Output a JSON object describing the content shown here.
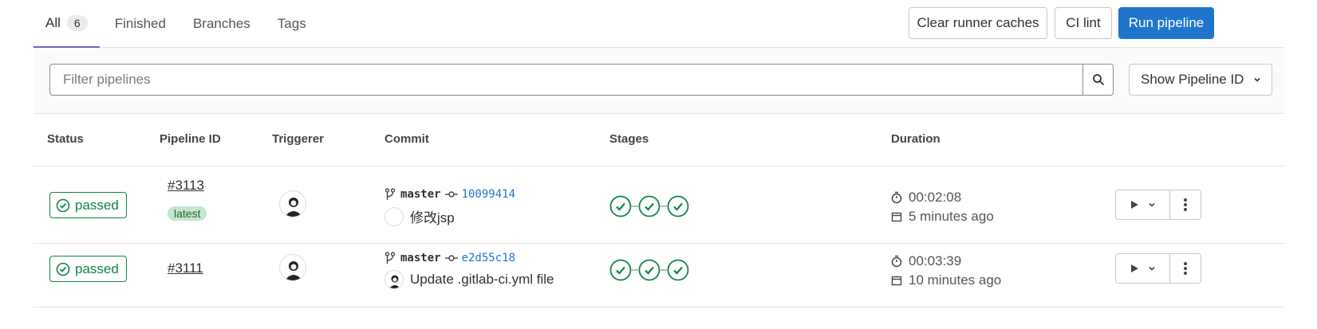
{
  "tabs": [
    {
      "label": "All",
      "count": "6"
    },
    {
      "label": "Finished"
    },
    {
      "label": "Branches"
    },
    {
      "label": "Tags"
    }
  ],
  "header_buttons": {
    "clear_cache": "Clear runner caches",
    "ci_lint": "CI lint",
    "run_pipeline": "Run pipeline"
  },
  "filter": {
    "placeholder": "Filter pipelines",
    "id_select": "Show Pipeline ID"
  },
  "columns": {
    "status": "Status",
    "pipeline_id": "Pipeline ID",
    "triggerer": "Triggerer",
    "commit": "Commit",
    "stages": "Stages",
    "duration": "Duration"
  },
  "pipelines": [
    {
      "status": "passed",
      "id": "#3113",
      "tag": "latest",
      "branch": "master",
      "sha": "10099414",
      "message": "修改jsp",
      "duration": "00:02:08",
      "finished": "5 minutes ago"
    },
    {
      "status": "passed",
      "id": "#3111",
      "branch": "master",
      "sha": "e2d55c18",
      "message": "Update .gitlab-ci.yml file",
      "duration": "00:03:39",
      "finished": "10 minutes ago"
    }
  ],
  "colors": {
    "success": "#108548",
    "primary": "#1f75cb",
    "tab_active": "#6666c4"
  }
}
